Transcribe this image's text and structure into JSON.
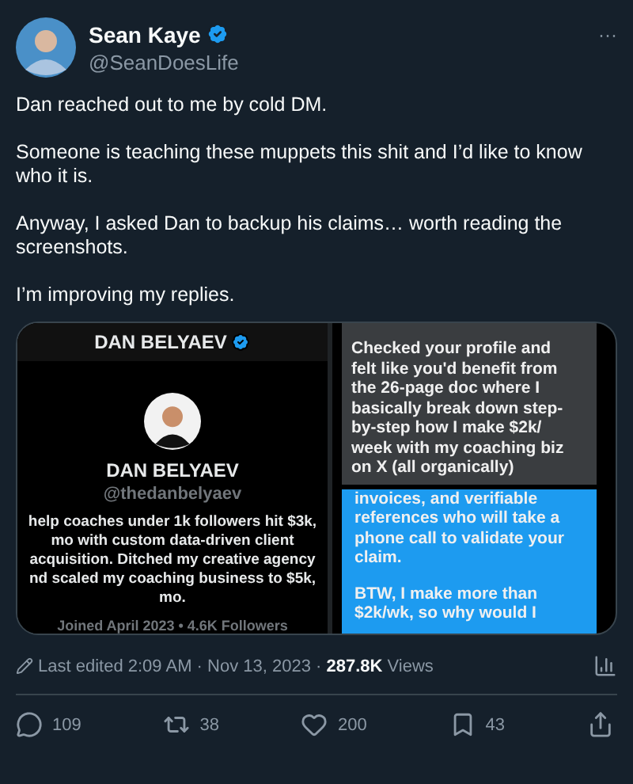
{
  "author": {
    "name": "Sean Kaye",
    "handle": "@SeanDoesLife",
    "verified": true
  },
  "more": "···",
  "paragraphs": [
    "Dan reached out to me by cold DM.",
    "Someone is teaching these muppets this shit and I’d like to know who it is.",
    "Anyway, I asked Dan to backup his claims… worth reading the screenshots.",
    "I’m improving my replies."
  ],
  "media": {
    "profile": {
      "header_name": "DAN BELYAEV",
      "verified": true,
      "name": "DAN BELYAEV",
      "handle": "@thedanbelyaev",
      "bio_lines": [
        "help coaches under 1k followers hit $3k,",
        "mo with custom data-driven client",
        "acquisition. Ditched my creative agency",
        "nd scaled my coaching business to $5k,",
        "mo."
      ],
      "meta": "Joined April 2023 • 4.6K Followers"
    },
    "messages": [
      {
        "kind": "received",
        "paragraphs": [
          "Checked your profile and felt like you'd benefit from the 26-page doc where I basically break down step-by-step how I make $2k/ week with my coaching biz on X (all organically)"
        ]
      },
      {
        "kind": "sent",
        "paragraphs": [
          "invoices, and verifiable references who will take a phone call to validate your claim.",
          "BTW, I make more than $2k/wk, so why would I"
        ]
      }
    ]
  },
  "meta": {
    "edited": "Last edited 2:09 AM · Nov 13, 2023 · ",
    "views_count": "287.8K",
    "views_label": " Views"
  },
  "actions": [
    {
      "kind": "reply",
      "count": "109"
    },
    {
      "kind": "repost",
      "count": "38"
    },
    {
      "kind": "like",
      "count": "200"
    },
    {
      "kind": "bookmark",
      "count": "43"
    },
    {
      "kind": "share"
    }
  ]
}
